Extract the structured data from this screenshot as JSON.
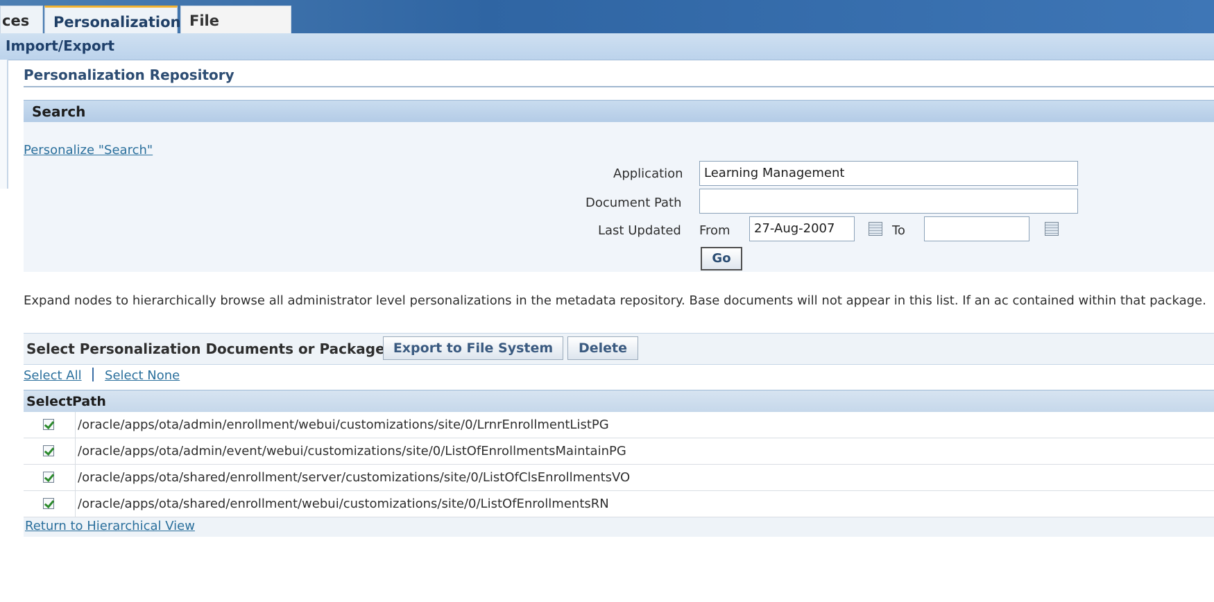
{
  "tabs": [
    {
      "label": "ces"
    },
    {
      "label": "Personalization",
      "active": true
    },
    {
      "label": "File Manager"
    }
  ],
  "subnav": {
    "label": "Import/Export"
  },
  "page": {
    "title": "Personalization Repository"
  },
  "search": {
    "header": "Search",
    "personalize_link": "Personalize \"Search\"",
    "application": {
      "label": "Application",
      "value": "Learning Management"
    },
    "document_path": {
      "label": "Document Path",
      "value": ""
    },
    "last_updated": {
      "label": "Last Updated",
      "from_label": "From",
      "from_value": "27-Aug-2007",
      "to_label": "To",
      "to_value": ""
    },
    "go_label": "Go"
  },
  "description": "Expand nodes to hierarchically browse all administrator level personalizations in the metadata repository. Base documents will not appear in this list. If an ac contained within that package.",
  "selection": {
    "label": "Select Personalization Documents or Package:",
    "export_label": "Export to File System",
    "delete_label": "Delete",
    "select_all": "Select All",
    "select_none": "Select None"
  },
  "table": {
    "columns": [
      "Select",
      "Path"
    ],
    "rows": [
      {
        "checked": true,
        "path": "/oracle/apps/ota/admin/enrollment/webui/customizations/site/0/LrnrEnrollmentListPG"
      },
      {
        "checked": true,
        "path": "/oracle/apps/ota/admin/event/webui/customizations/site/0/ListOfEnrollmentsMaintainPG"
      },
      {
        "checked": true,
        "path": "/oracle/apps/ota/shared/enrollment/server/customizations/site/0/ListOfClsEnrollmentsVO"
      },
      {
        "checked": true,
        "path": "/oracle/apps/ota/shared/enrollment/webui/customizations/site/0/ListOfEnrollmentsRN"
      }
    ]
  },
  "footer": {
    "return_link": "Return to Hierarchical View"
  }
}
